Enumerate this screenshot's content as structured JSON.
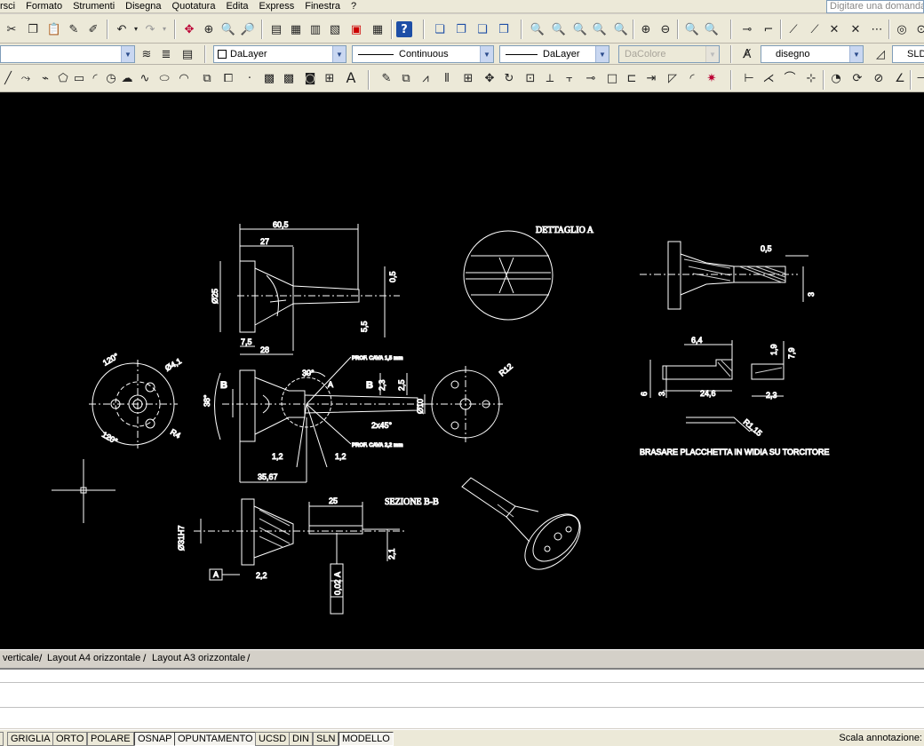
{
  "menu": {
    "items": [
      "rsci",
      "Formato",
      "Strumenti",
      "Disegna",
      "Quotatura",
      "Edita",
      "Express",
      "Finestra",
      "?"
    ],
    "help_placeholder": "Digitare una domanda"
  },
  "properties": {
    "layer_combo": "",
    "color": "DaLayer",
    "linetype": "Continuous",
    "lineweight": "DaLayer",
    "plotstyle": "DaColore",
    "textstyle": "disegno",
    "dimstyle": "SLD"
  },
  "drawing": {
    "dims": {
      "d60_5": "60,5",
      "d27": "27",
      "d05a": "0,5",
      "d025": "Ø25",
      "d5_5": "5,5",
      "d7_5": "7,5",
      "d28": "28",
      "d120a": "120°",
      "d4_1": "Ø4,1",
      "d120b": "120°",
      "r4": "R4",
      "d30": "30°",
      "d38": "38°",
      "dA": "A",
      "dB1": "B",
      "dB2": "B",
      "d2_3a": "2,3",
      "d2_5": "2,5",
      "d10": "Ø10",
      "d2x45": "2x45°",
      "d1_2a": "1,2",
      "d1_2b": "1,2",
      "d35_67": "35,67",
      "r12": "R12",
      "prof1": "PROF. CAVA 1,5 mm",
      "prof2": "PROF. CAVA 2,2 mm",
      "d0_5b": "0,5",
      "d3a": "3",
      "d6_4": "6,4",
      "d1_9": "1,9",
      "d7_9": "7,9",
      "d6": "6",
      "d3b": "3",
      "d24_6": "24,6",
      "d2_3b": "2,3",
      "r1_15": "R1,15",
      "d25": "25",
      "d31": "Ø31H7",
      "d2_1": "2,1",
      "d2_2": "2,2",
      "datA": "A",
      "ftol1": "0,02",
      "ftol2": "A"
    },
    "labels": {
      "dettaglio": "DETTAGLIO A",
      "sezione": "SEZIONE B-B",
      "note": "BRASARE PLACCHETTA IN WIDIA SU TORCITORE"
    }
  },
  "layout_tabs": [
    "verticale",
    "Layout A4 orizzontale",
    "Layout A3 orizzontale"
  ],
  "status_bar": {
    "buttons": [
      "GRIGLIA",
      "ORTO",
      "POLARE",
      "OSNAP",
      "OPUNTAMENTO",
      "UCSD",
      "DIN",
      "SLN",
      "MODELLO"
    ],
    "scale_label": "Scala annotazione:"
  }
}
